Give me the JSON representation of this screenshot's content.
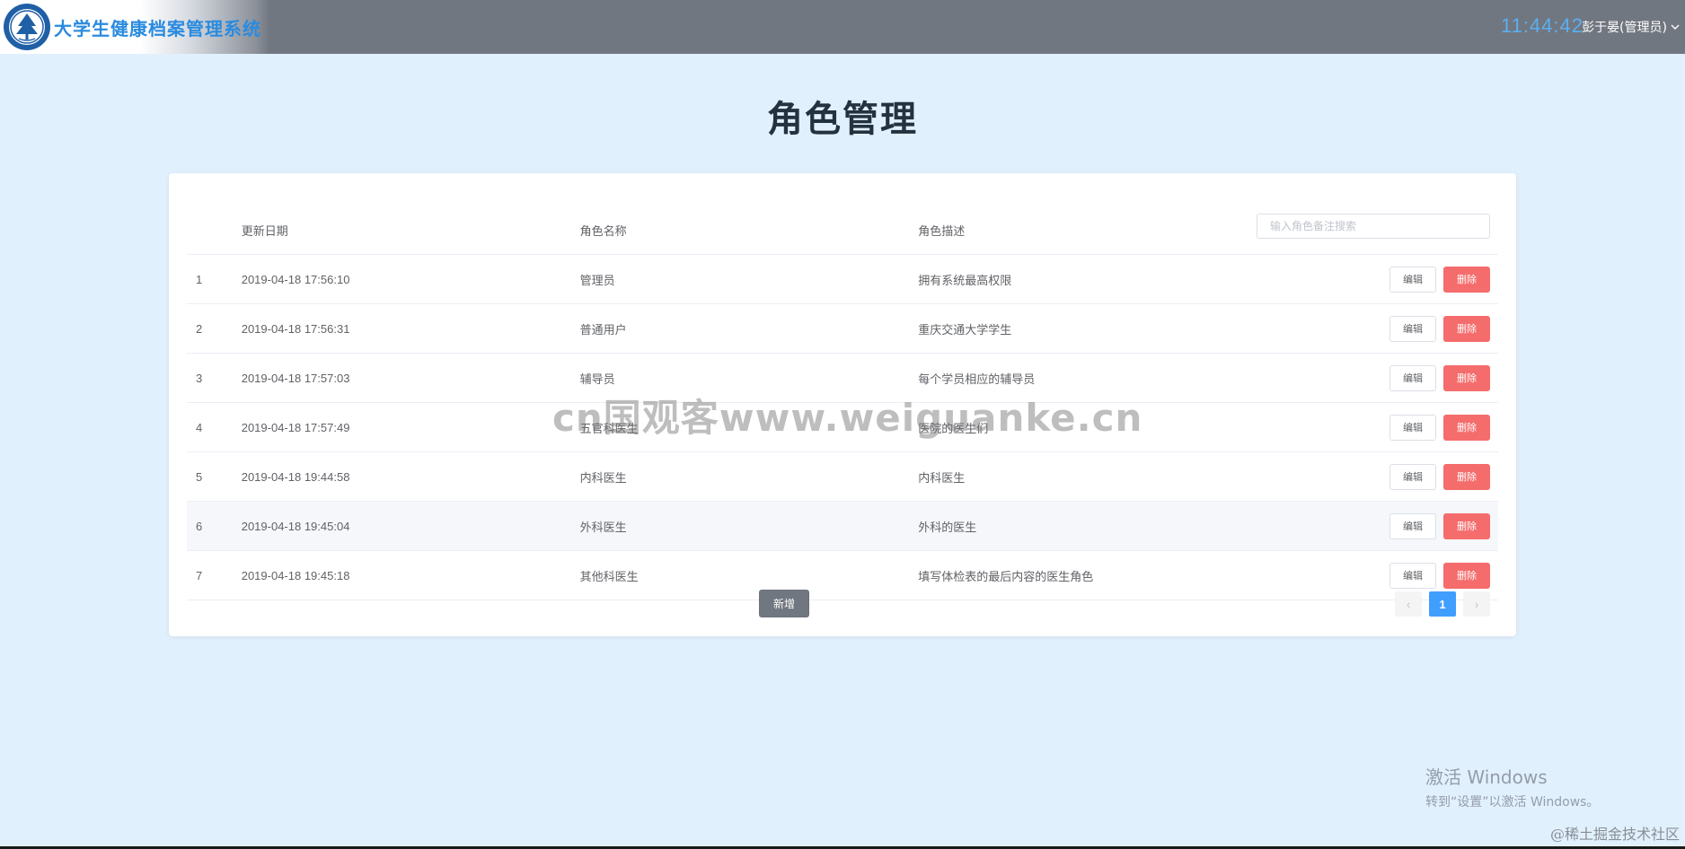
{
  "header": {
    "app_title": "大学生健康档案管理系统",
    "clock": "11:44:42",
    "user": "彭于晏(管理员)"
  },
  "page": {
    "title": "角色管理"
  },
  "table": {
    "columns": [
      "更新日期",
      "角色名称",
      "角色描述"
    ],
    "search_placeholder": "输入角色备注搜索",
    "rows": [
      {
        "index": "1",
        "date": "2019-04-18 17:56:10",
        "name": "管理员",
        "desc": "拥有系统最高权限"
      },
      {
        "index": "2",
        "date": "2019-04-18 17:56:31",
        "name": "普通用户",
        "desc": "重庆交通大学学生"
      },
      {
        "index": "3",
        "date": "2019-04-18 17:57:03",
        "name": "辅导员",
        "desc": "每个学员相应的辅导员"
      },
      {
        "index": "4",
        "date": "2019-04-18 17:57:49",
        "name": "五官科医生",
        "desc": "医院的医生们"
      },
      {
        "index": "5",
        "date": "2019-04-18 19:44:58",
        "name": "内科医生",
        "desc": "内科医生"
      },
      {
        "index": "6",
        "date": "2019-04-18 19:45:04",
        "name": "外科医生",
        "desc": "外科的医生"
      },
      {
        "index": "7",
        "date": "2019-04-18 19:45:18",
        "name": "其他科医生",
        "desc": "填写体检表的最后内容的医生角色"
      }
    ],
    "edit_label": "编辑",
    "delete_label": "删除"
  },
  "actions": {
    "add_label": "新增"
  },
  "pagination": {
    "prev": "‹",
    "current": "1",
    "next": "›"
  },
  "overlays": {
    "watermark": "cn国观客www.weiguanke.cn",
    "windows_line1": "激活 Windows",
    "windows_line2": "转到“设置”以激活 Windows。",
    "corner": "@稀土掘金技术社区"
  },
  "colors": {
    "header_bg": "#717780",
    "page_bg": "#e1f0fd",
    "brand_text": "#2a8bdf",
    "clock": "#5aaff2",
    "danger": "#f56c6c",
    "primary": "#409eff"
  }
}
